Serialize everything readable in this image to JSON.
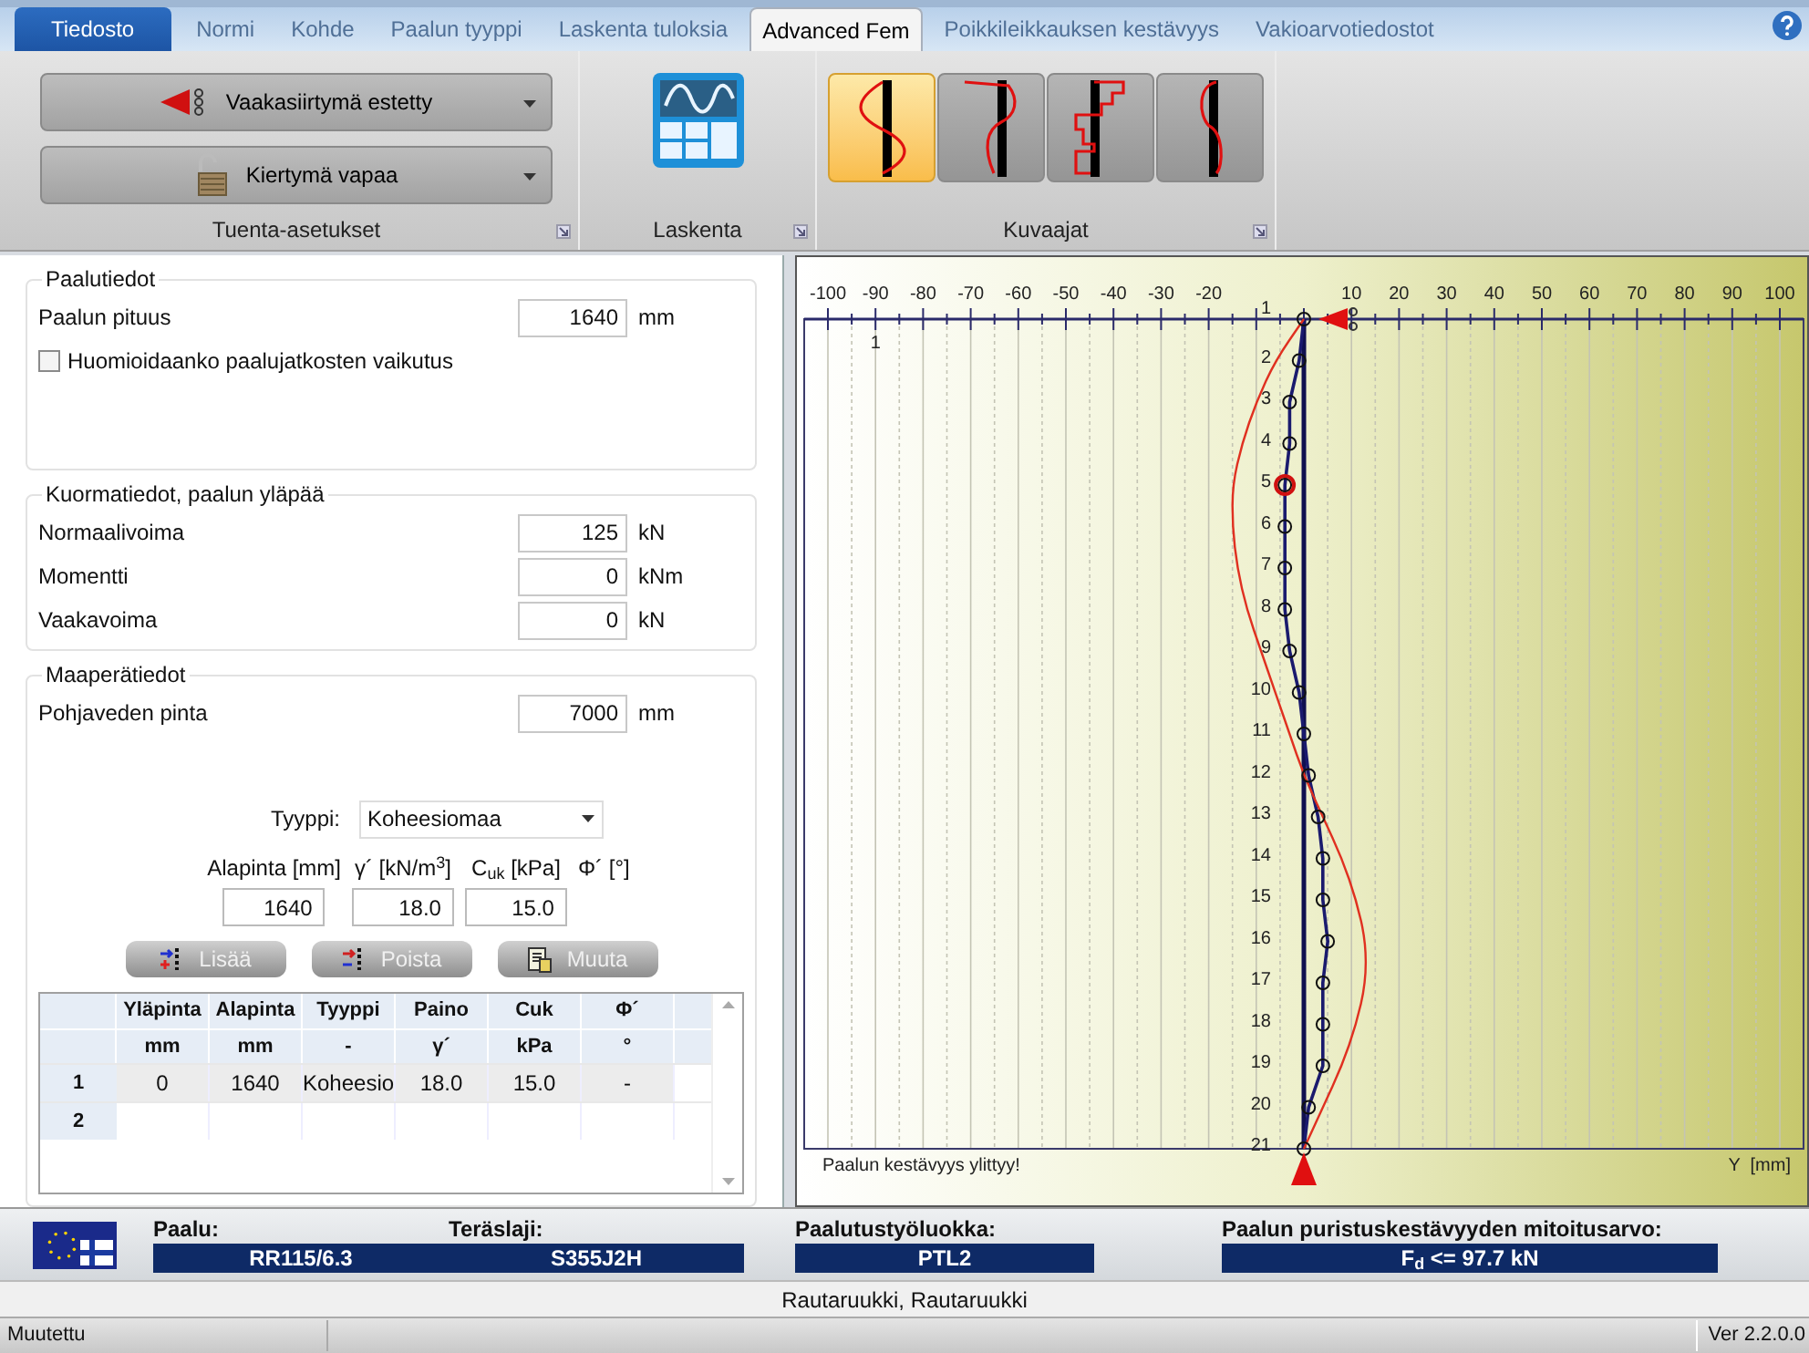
{
  "tabs": [
    {
      "label": "Tiedosto",
      "kind": "file",
      "selected": false
    },
    {
      "label": "Normi",
      "kind": "page",
      "selected": false
    },
    {
      "label": "Kohde",
      "kind": "page",
      "selected": false
    },
    {
      "label": "Paalun tyyppi",
      "kind": "page",
      "selected": false
    },
    {
      "label": "Laskenta tuloksia",
      "kind": "page",
      "selected": false
    },
    {
      "label": "Advanced Fem",
      "kind": "page",
      "selected": true
    },
    {
      "label": "Poikkileikkauksen kestävyys",
      "kind": "page",
      "selected": false
    },
    {
      "label": "Vakioarvotiedostot",
      "kind": "page",
      "selected": false
    }
  ],
  "ribbon": {
    "supports": {
      "label": "Tuenta-asetukset",
      "items": [
        {
          "label": "Vaakasiirtymä estetty",
          "kind": "horizontal"
        },
        {
          "label": "Kiertymä vapaa",
          "kind": "rotation"
        }
      ]
    },
    "calculation": {
      "label": "Laskenta"
    },
    "charts": {
      "label": "Kuvaajat",
      "items": [
        {
          "kind": "deflection",
          "selected": true
        },
        {
          "kind": "moment",
          "selected": false
        },
        {
          "kind": "shear",
          "selected": false
        },
        {
          "kind": "pressure",
          "selected": false
        }
      ]
    }
  },
  "pile_data": {
    "legend": "Paalutiedot",
    "length": {
      "label": "Paalun pituus",
      "value": "1640",
      "unit": "mm"
    },
    "joints": {
      "label": "Huomioidaanko paalujatkosten vaikutus",
      "checked": false
    }
  },
  "loads": {
    "legend": "Kuormatiedot, paalun yläpää",
    "fields": [
      {
        "label": "Normaalivoima",
        "value": "125",
        "unit": "kN"
      },
      {
        "label": "Momentti",
        "value": "0",
        "unit": "kNm"
      },
      {
        "label": "Vaakavoima",
        "value": "0",
        "unit": "kN"
      }
    ]
  },
  "soil": {
    "legend": "Maaperätiedot",
    "groundwater": {
      "label": "Pohjaveden pinta",
      "value": "7000",
      "unit": "mm"
    },
    "type": {
      "label": "Tyyppi:",
      "value": "Koheesiomaa"
    },
    "layer_fields": [
      {
        "label": "Alapinta [mm]",
        "value": "1640"
      },
      {
        "label": "γ´ [kN/m$^{3}$]",
        "value": "18.0"
      },
      {
        "label": "C$_{uk}$ [kPa]",
        "value": "15.0"
      },
      {
        "label": "Φ´ [°]"
      }
    ],
    "buttons": [
      {
        "label": "Lisää",
        "kind": "add",
        "disabled": true
      },
      {
        "label": "Poista",
        "kind": "remove",
        "disabled": true
      },
      {
        "label": "Muuta",
        "kind": "edit",
        "disabled": true
      }
    ],
    "table": {
      "columns": [
        {
          "name": "Yläpinta",
          "unit": "mm"
        },
        {
          "name": "Alapinta",
          "unit": "mm"
        },
        {
          "name": "Tyyppi",
          "unit": "-"
        },
        {
          "name": "Paino",
          "unit": "γ´"
        },
        {
          "name": "Cuk",
          "unit": "kPa"
        },
        {
          "name": "Φ´",
          "unit": "°"
        }
      ],
      "rows": [
        {
          "header": "1",
          "cells": [
            "0",
            "1640",
            "Koheesio",
            "18.0",
            "15.0",
            "-"
          ]
        },
        {
          "header": "2"
        }
      ]
    }
  },
  "chart": {
    "layer_label": "1",
    "warning": "Paalun kestävyys ylittyy!",
    "axis_label": "Y  [mm]",
    "tick_labels": [
      {
        "text": "-100",
        "kind": "left"
      },
      {
        "text": "-90",
        "kind": "left"
      },
      {
        "text": "-80",
        "kind": "left"
      },
      {
        "text": "-70",
        "kind": "left"
      },
      {
        "text": "-60",
        "kind": "left"
      },
      {
        "text": "-50",
        "kind": "left"
      },
      {
        "text": "-40",
        "kind": "left"
      },
      {
        "text": "-30",
        "kind": "left"
      },
      {
        "text": "-20",
        "kind": "left"
      },
      {
        "text": "10",
        "kind": "right"
      },
      {
        "text": "20",
        "kind": "right"
      },
      {
        "text": "30",
        "kind": "right"
      },
      {
        "text": "40",
        "kind": "right"
      },
      {
        "text": "50",
        "kind": "right"
      },
      {
        "text": "60",
        "kind": "right"
      },
      {
        "text": "70",
        "kind": "right"
      },
      {
        "text": "80",
        "kind": "right"
      },
      {
        "text": "90",
        "kind": "right"
      },
      {
        "text": "100",
        "kind": "right"
      }
    ],
    "node_labels": [
      "1",
      "2",
      "3",
      "4",
      "5",
      "6",
      "7",
      "8",
      "9",
      "10",
      "11",
      "12",
      "13",
      "14",
      "15",
      "16",
      "17",
      "18",
      "19",
      "20",
      "21"
    ]
  },
  "info": {
    "pile": {
      "label": "Paalu:",
      "value": "RR115/6.3"
    },
    "steel": {
      "label": "Teräslaji:",
      "value": "S355J2H"
    },
    "work_class": {
      "label": "Paalutustyöluokka:",
      "value": "PTL2"
    },
    "capacity": {
      "label": "Paalun puristuskestävyyden mitoitusarvo:",
      "value": "F$_{d}$ <= 97.7 kN"
    }
  },
  "manufacturer": "Rautaruukki, Rautaruukki",
  "status_bar": {
    "state": "Muutettu",
    "version": "Ver 2.2.0.0"
  }
}
